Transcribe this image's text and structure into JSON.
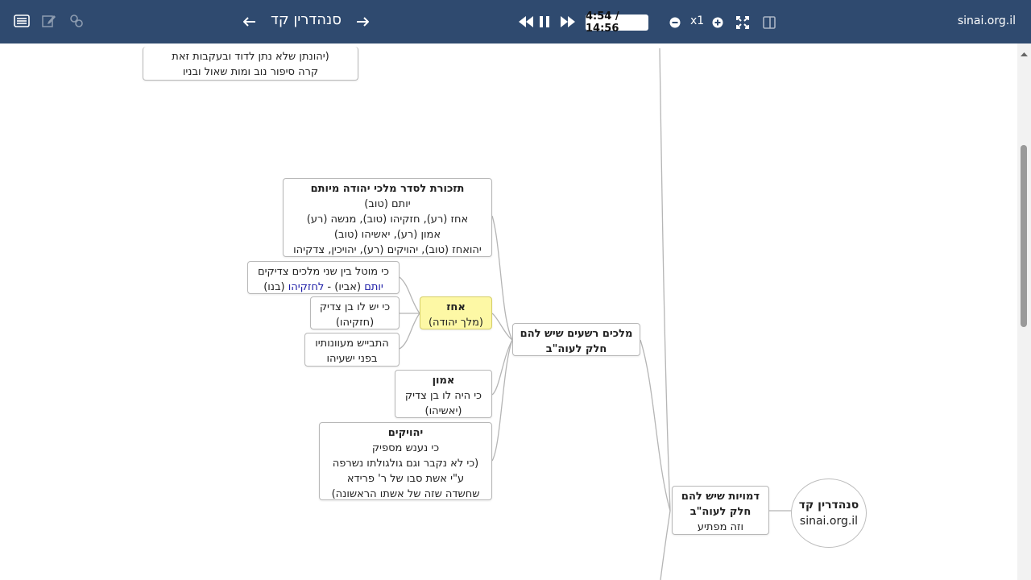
{
  "header": {
    "title": "סנהדרין קד",
    "time": "4:54 / 14:56",
    "zoom": "x1",
    "site": "sinai.org.il"
  },
  "icons": {
    "list": "list-icon",
    "edit": "edit-icon",
    "link": "link-icon",
    "prev": "arrow-left-icon",
    "next": "arrow-right-icon",
    "rewind": "rewind-icon",
    "pause": "pause-icon",
    "forward": "fast-forward-icon",
    "minus": "zoom-out-icon",
    "plus": "zoom-in-icon",
    "fullscreen": "fullscreen-icon",
    "split": "split-view-icon"
  },
  "map": {
    "top_node": {
      "line1": "(יהונתן שלא נתן לדוד ובעקבות זאת",
      "line2": "קרה סיפור נוב ומות שאול ובניו"
    },
    "reminder": {
      "title": "תזכורת לסדר מלכי יהודה מיותם",
      "line1": "יותם (טוב)",
      "line2": "אחז (רע), חזקיהו (טוב), מנשה (רע)",
      "line3": "אמון (רע), יאשיהו (טוב)",
      "line4": "יהואחז (טוב), יהויקים (רע), יהויכין, צדקיהו"
    },
    "between": {
      "line1": "כי מוטל בין שני מלכים צדיקים",
      "p1": "יותם",
      "p2": " (אביו) - ",
      "p3": "לחזקיהו",
      "p4": " (בנו)"
    },
    "has_son": {
      "line1": "כי יש לו בן צדיק",
      "line2": "(חזקיהו)"
    },
    "ashamed": {
      "line1": "התבייש מעוונותיו",
      "line2": "בפני ישעיהו"
    },
    "achaz": {
      "title": "אחז",
      "sub": "(מלך יהודה)"
    },
    "evil_kings": {
      "line1": "מלכים רשעים שיש להם",
      "line2": "חלק לעוה\"ב"
    },
    "amon": {
      "title": "אמון",
      "line1": "כי היה לו בן צדיק",
      "line2": "(יאשיהו)"
    },
    "yehoyakim": {
      "title": "יהויקים",
      "line1": "כי נענש מספיק",
      "line2": "(כי לא נקבר וגם גולגולתו  נשרפה",
      "line3": "ע\"י אשת סבו של ר' פרידא",
      "line4": "שחשדה שזה של אשתו הראשונה)"
    },
    "figures": {
      "line1": "דמויות שיש להם",
      "line2": "חלק לעוה\"ב",
      "line3": "וזה מפתיע"
    },
    "root": {
      "line1": "סנהדרין קד",
      "line2": "sinai.org.il"
    }
  },
  "colors": {
    "topbar": "#2f4a6f",
    "highlight": "#fdf8a5",
    "link_blue": "#1a1aa6",
    "connector": "#b5b5b5"
  }
}
